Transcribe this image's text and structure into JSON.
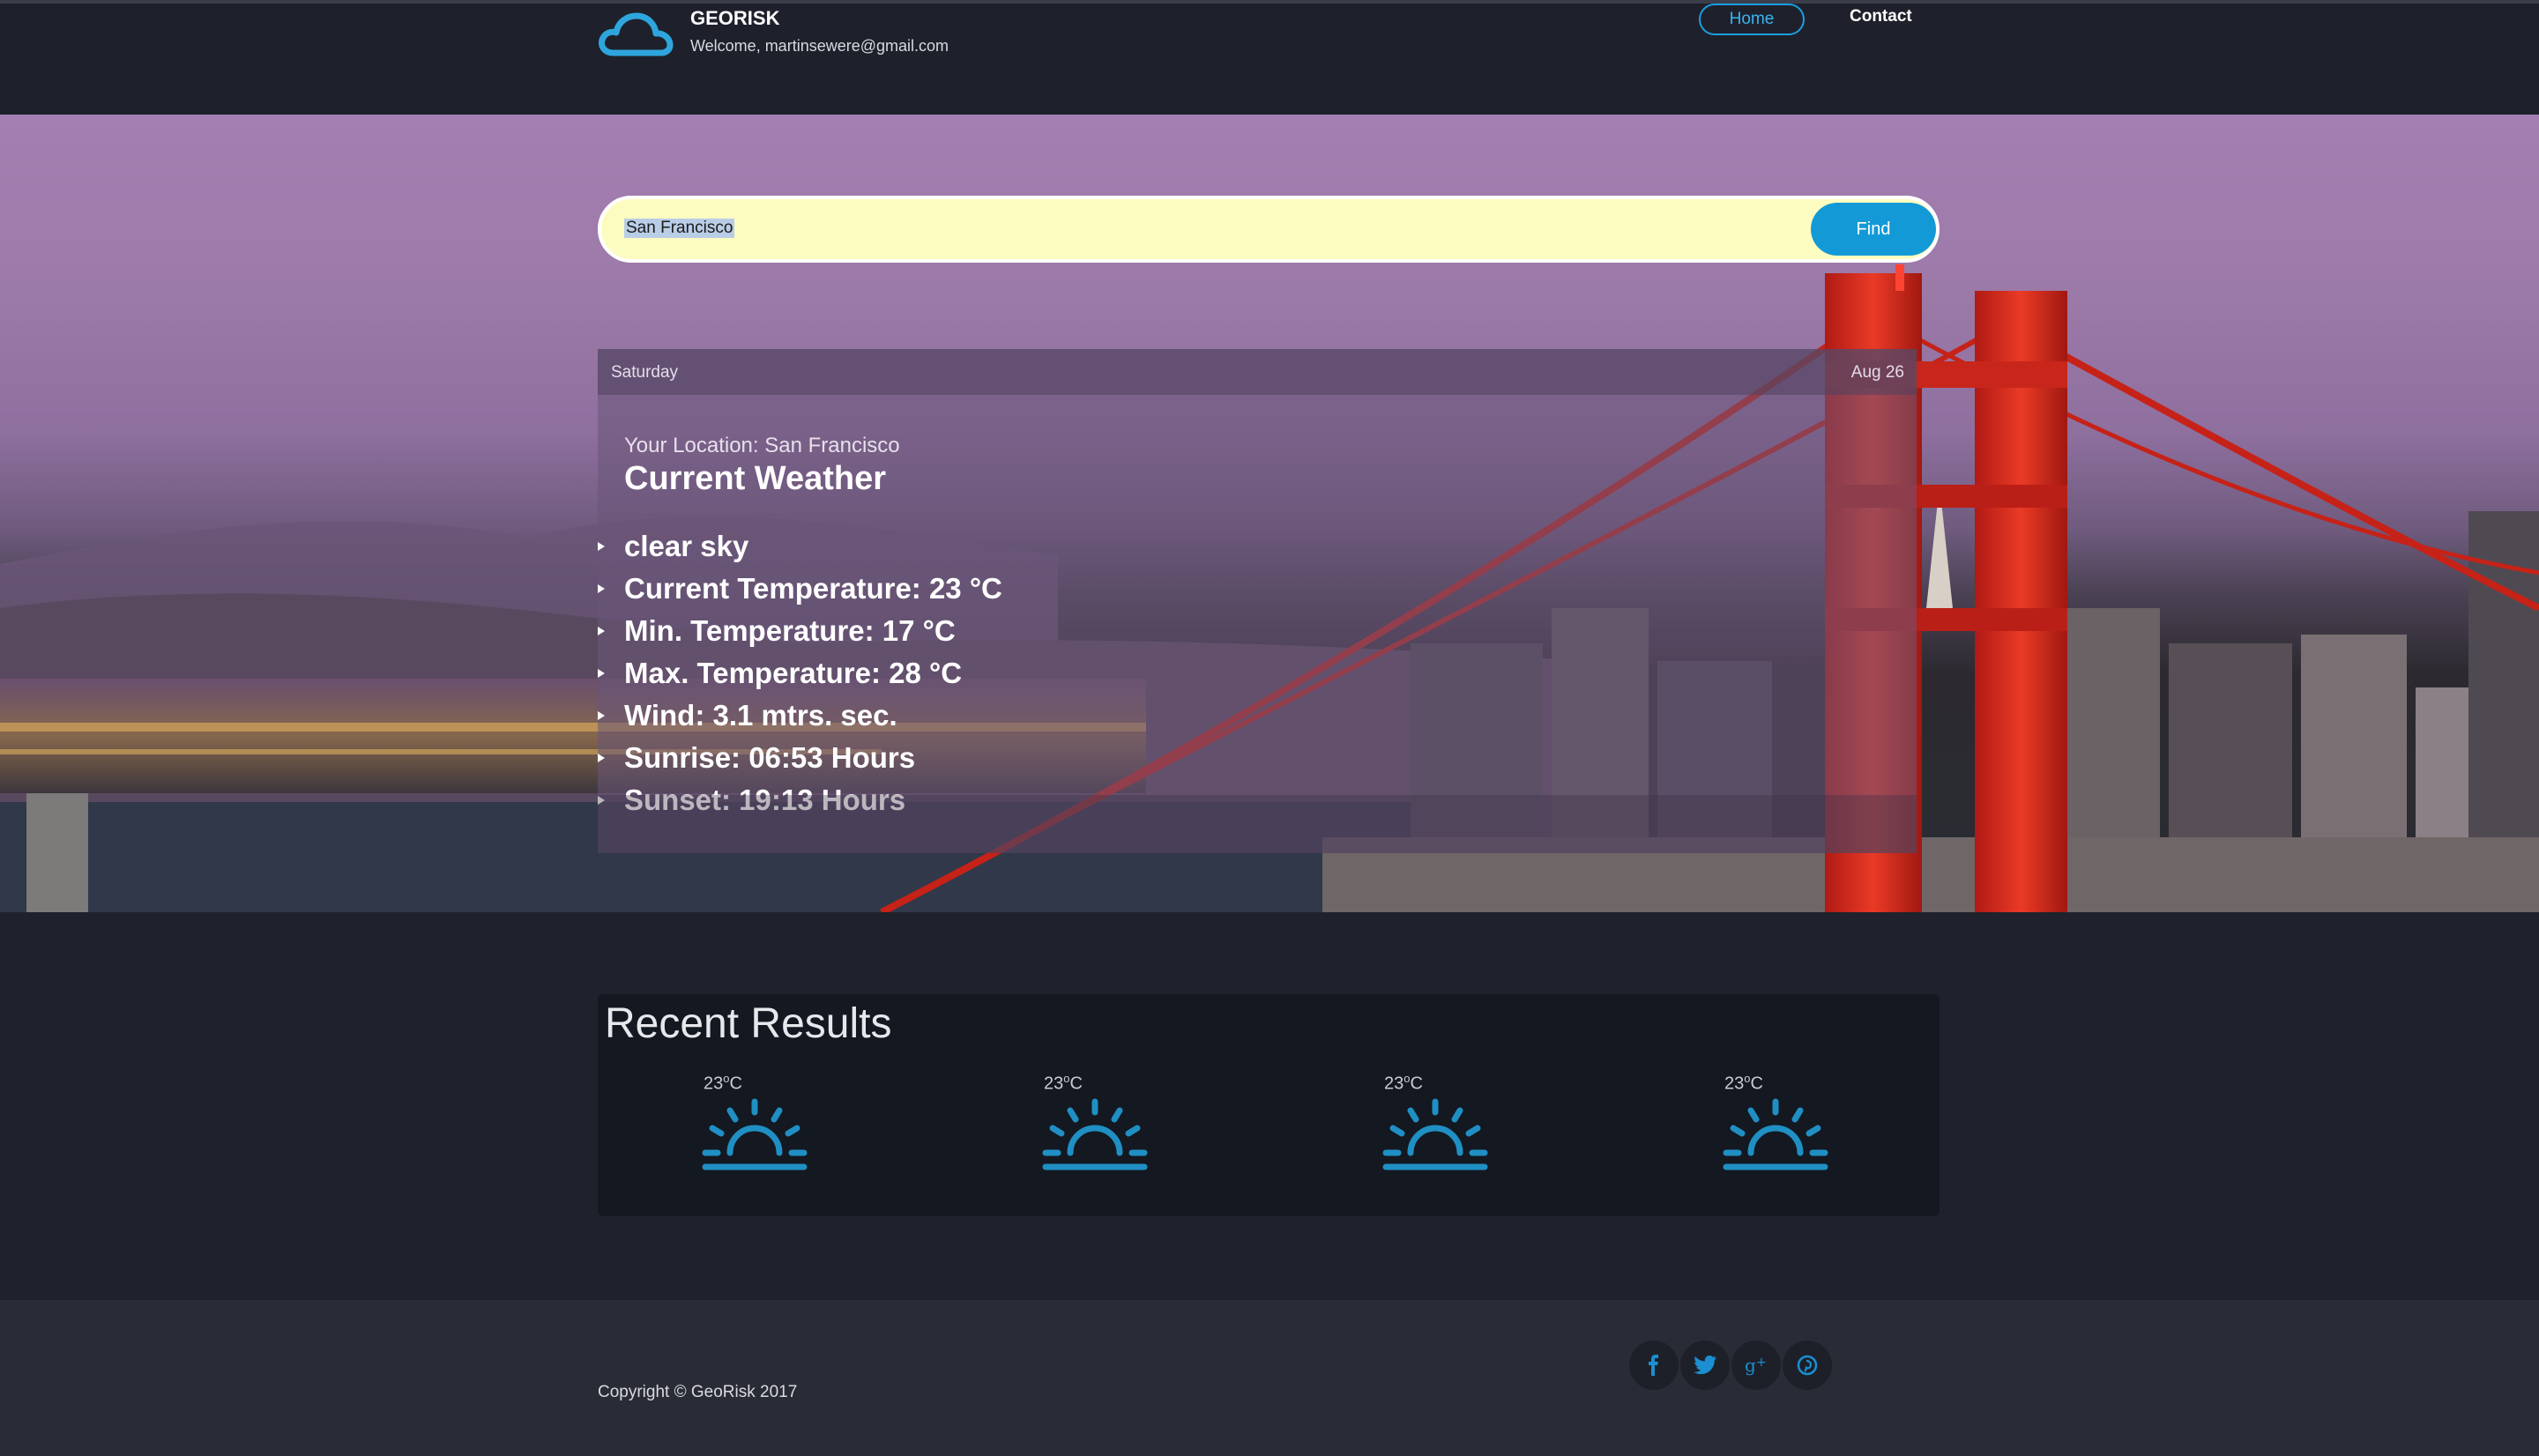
{
  "header": {
    "brand": "GEORISK",
    "welcome": "Welcome, martinsewere@gmail.com",
    "logo_icon": "cloud-icon",
    "nav": [
      {
        "label": "Home",
        "active": true
      },
      {
        "label": "Contact",
        "active": false
      }
    ]
  },
  "search": {
    "value": "San Francisco",
    "button_label": "Find"
  },
  "weather": {
    "day": "Saturday",
    "date": "Aug 26",
    "location": "Your Location: San Francisco",
    "title": "Current Weather",
    "items": [
      "clear sky",
      "Current Temperature: 23 °C",
      "Min. Temperature: 17 °C",
      "Max. Temperature: 28 °C",
      "Wind: 3.1 mtrs. sec.",
      "Sunrise: 06:53 Hours",
      "Sunset: 19:13 Hours"
    ]
  },
  "recent": {
    "title": "Recent Results",
    "results": [
      {
        "temp": "23",
        "unit": "C",
        "icon": "sunrise-icon"
      },
      {
        "temp": "23",
        "unit": "C",
        "icon": "sunrise-icon"
      },
      {
        "temp": "23",
        "unit": "C",
        "icon": "sunrise-icon"
      },
      {
        "temp": "23",
        "unit": "C",
        "icon": "sunrise-icon"
      }
    ]
  },
  "footer": {
    "copyright": "Copyright © GeoRisk 2017",
    "social": [
      "facebook-icon",
      "twitter-icon",
      "google-plus-icon",
      "pinterest-icon"
    ]
  },
  "colors": {
    "accent": "#139ad6",
    "background": "#1f222c",
    "search_bg": "#fdfcc0",
    "bridge_red": "#d42a1f"
  }
}
